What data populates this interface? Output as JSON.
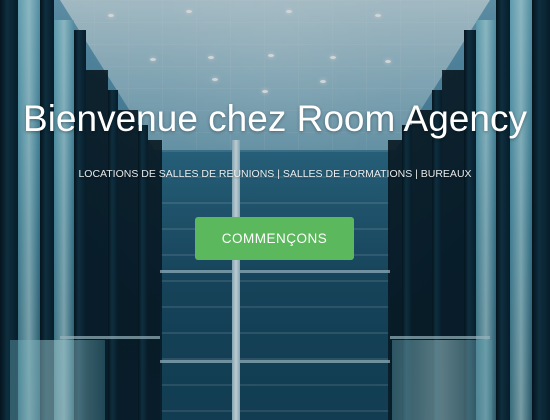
{
  "hero": {
    "title": "Bienvenue chez Room Agency",
    "subtitle": "LOCATIONS DE SALLES DE REUNIONS | SALLES DE FORMATIONS | BUREAUX",
    "cta_label": "COMMENÇONS"
  },
  "colors": {
    "cta_background": "#5cb85c",
    "text": "#ffffff"
  }
}
